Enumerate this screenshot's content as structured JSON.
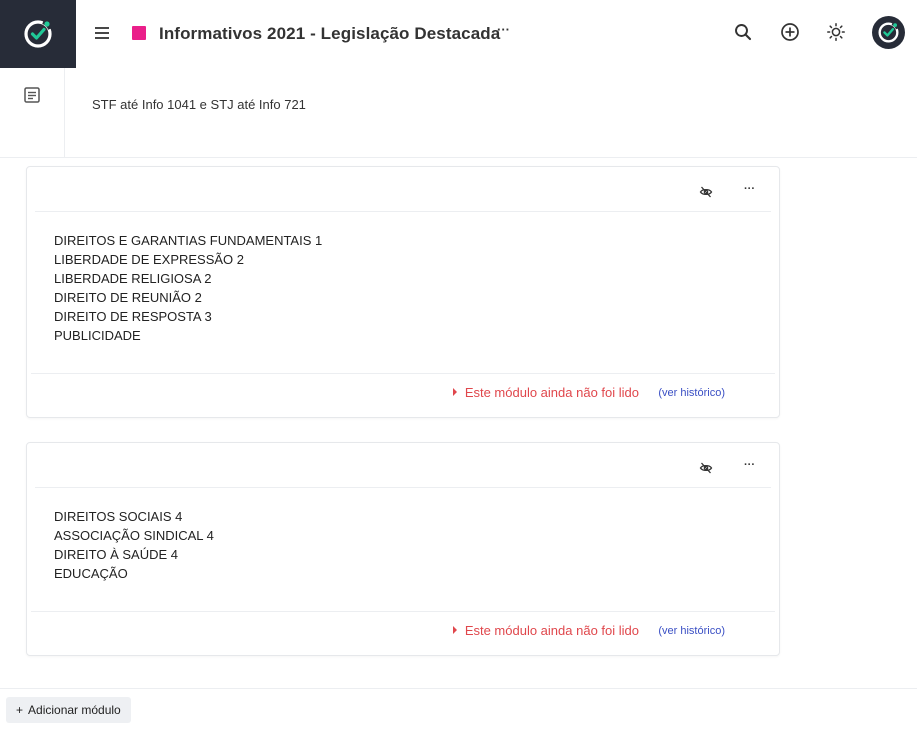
{
  "app": {
    "logo_icon": "check-circle-logo-icon",
    "brand_color": "#272c38",
    "accent_color": "#20c997"
  },
  "header": {
    "title": "Informativos 2021 - Legislação Destacada",
    "title_marker_color": "#ea1f8a",
    "more_label": "···",
    "icons": [
      "menu-icon",
      "search-icon",
      "add-circle-icon",
      "sun-icon",
      "avatar"
    ]
  },
  "sidebar": {
    "icons": [
      "document-icon"
    ]
  },
  "subtitle": "STF até Info 1041 e STJ até Info 721",
  "modules": [
    {
      "more_label": "···",
      "lines": [
        "DIREITOS E GARANTIAS FUNDAMENTAIS 1",
        "LIBERDADE DE EXPRESSÃO 2",
        "LIBERDADE RELIGIOSA 2",
        "DIREITO DE REUNIÃO 2",
        "DIREITO DE RESPOSTA 3",
        "PUBLICIDADE"
      ],
      "status": "Este módulo ainda não foi lido",
      "history": "(ver histórico)"
    },
    {
      "more_label": "···",
      "lines": [
        "DIREITOS SOCIAIS 4",
        "ASSOCIAÇÃO SINDICAL 4",
        "DIREITO À SAÚDE 4",
        "EDUCAÇÃO"
      ],
      "status": "Este módulo ainda não foi lido",
      "history": "(ver histórico)"
    }
  ],
  "footer": {
    "add_plus": "+",
    "add_label": "Adicionar módulo"
  },
  "colors": {
    "unread": "#e0474c",
    "link": "#3a4fc4"
  }
}
